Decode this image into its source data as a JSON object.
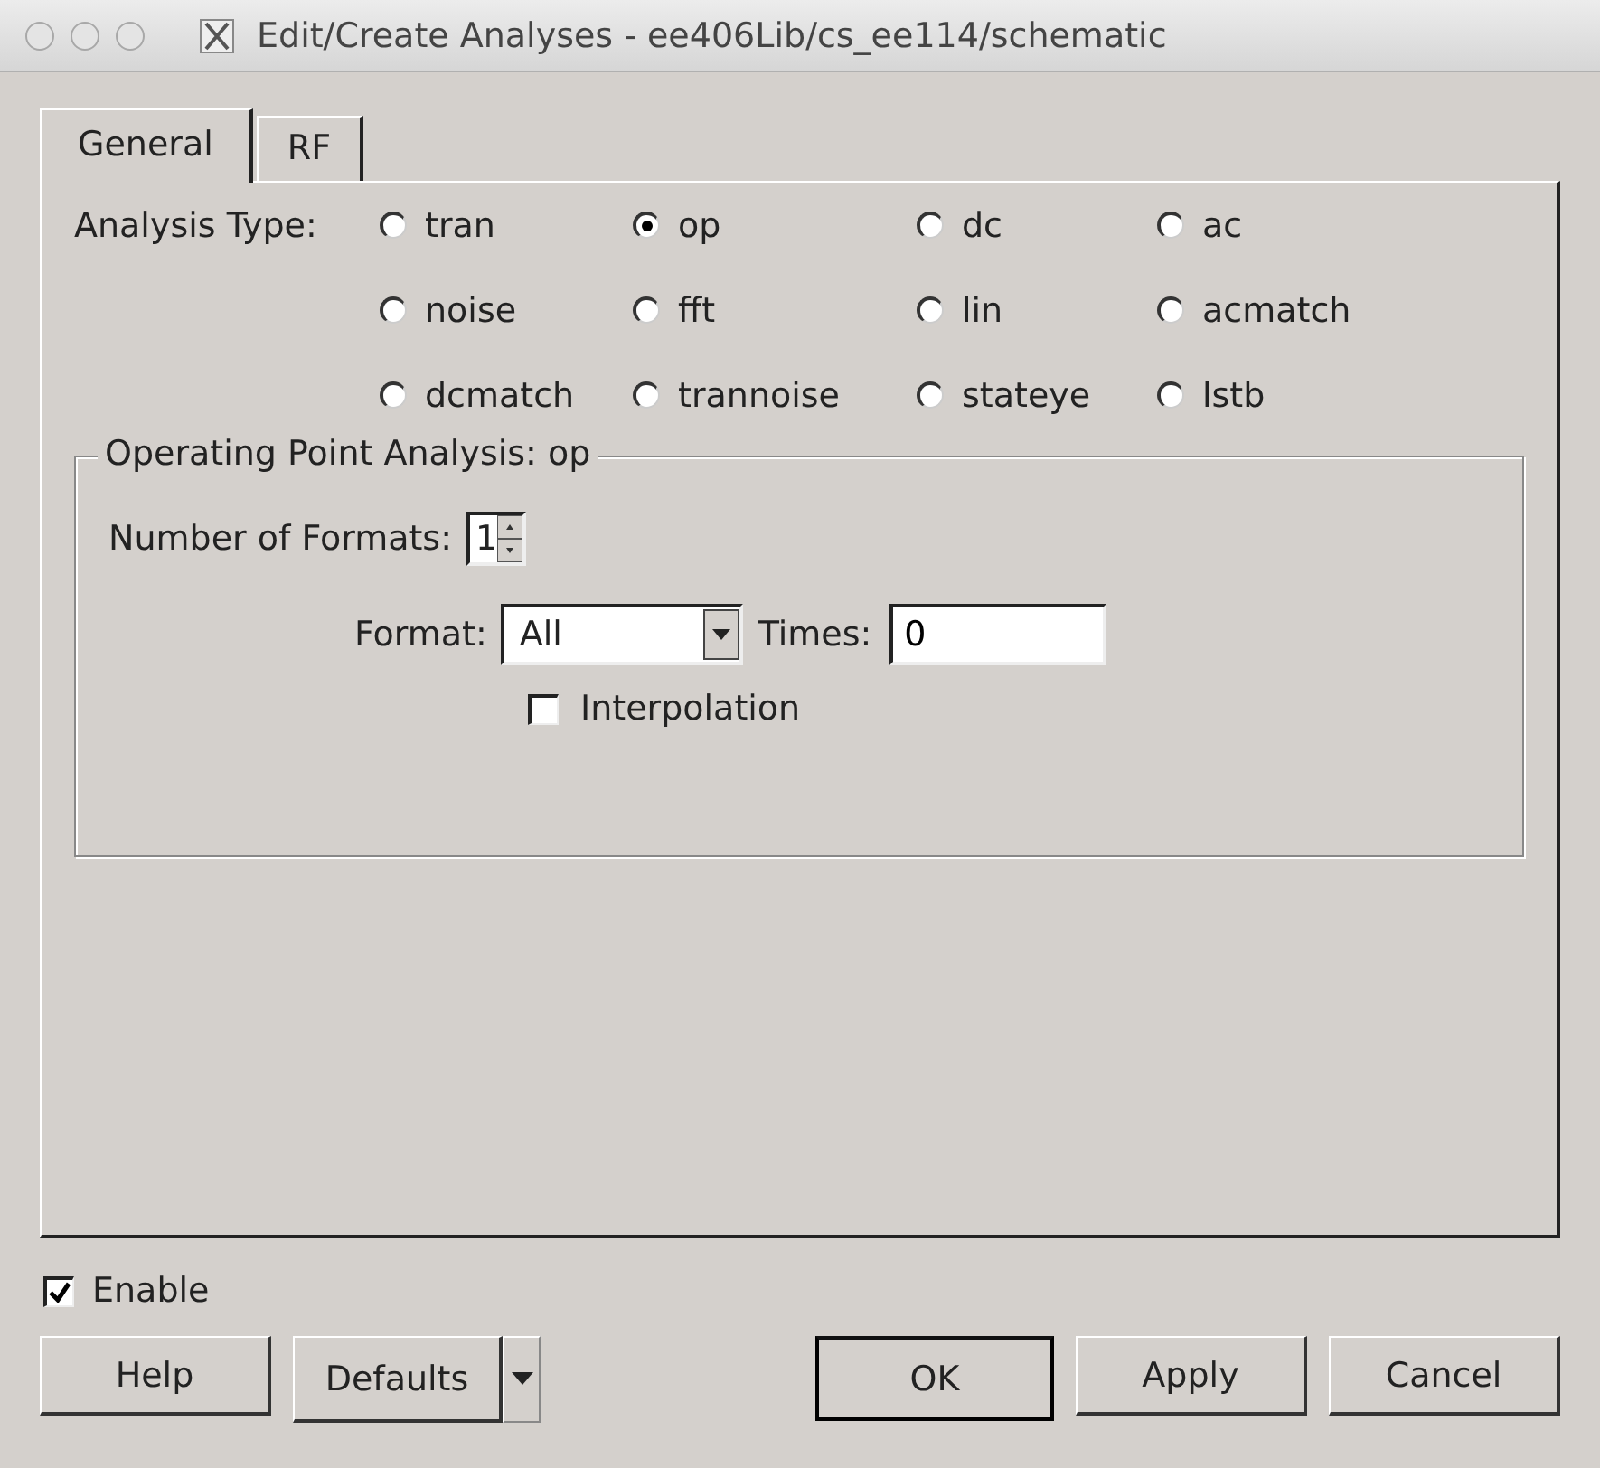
{
  "window": {
    "title": "Edit/Create Analyses - ee406Lib/cs_ee114/schematic"
  },
  "tabs": [
    {
      "label": "General",
      "selected": true
    },
    {
      "label": "RF",
      "selected": false
    }
  ],
  "analysis_type": {
    "label": "Analysis Type:",
    "options": [
      {
        "label": "tran",
        "selected": false
      },
      {
        "label": "op",
        "selected": true
      },
      {
        "label": "dc",
        "selected": false
      },
      {
        "label": "ac",
        "selected": false
      },
      {
        "label": "noise",
        "selected": false
      },
      {
        "label": "fft",
        "selected": false
      },
      {
        "label": "lin",
        "selected": false
      },
      {
        "label": "acmatch",
        "selected": false
      },
      {
        "label": "dcmatch",
        "selected": false
      },
      {
        "label": "trannoise",
        "selected": false
      },
      {
        "label": "stateye",
        "selected": false
      },
      {
        "label": "lstb",
        "selected": false
      }
    ]
  },
  "group": {
    "title": "Operating Point Analysis: op",
    "number_of_formats": {
      "label": "Number of Formats:",
      "value": "1"
    },
    "format": {
      "label": "Format:",
      "value": "All"
    },
    "times": {
      "label": "Times:",
      "value": "0"
    },
    "interpolation": {
      "label": "Interpolation",
      "checked": false
    }
  },
  "enable": {
    "label": "Enable",
    "checked": true
  },
  "buttons": [
    {
      "label": "Help",
      "kind": "button"
    },
    {
      "label": "Defaults",
      "kind": "split"
    },
    {
      "label": "OK",
      "kind": "default"
    },
    {
      "label": "Apply",
      "kind": "button"
    },
    {
      "label": "Cancel",
      "kind": "button"
    }
  ]
}
